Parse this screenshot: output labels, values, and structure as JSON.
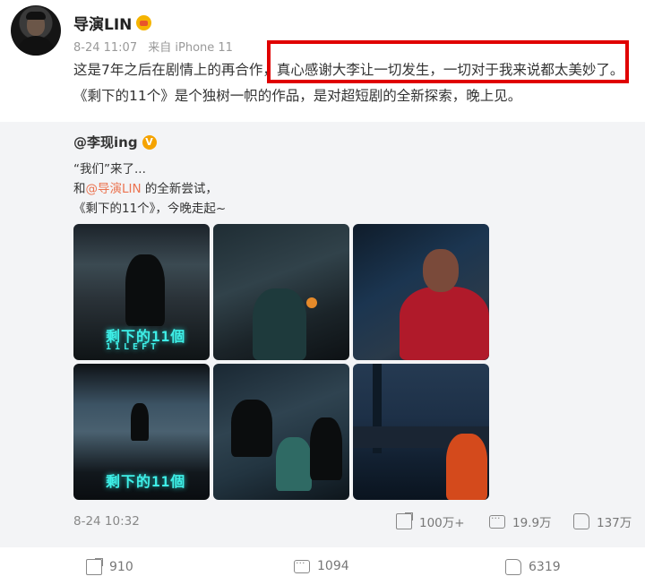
{
  "author": {
    "name": "导演LIN"
  },
  "meta": {
    "time": "8-24 11:07",
    "source": "来自 iPhone 11"
  },
  "post_text": "这是7年之后在剧情上的再合作，真心感谢大李让一切发生，一切对于我来说都太美妙了。《剩下的11个》是个独树一帜的作品，是对超短剧的全新探索，晚上见。",
  "repost": {
    "author": "@李现ing",
    "line1": "“我们”来了...",
    "line2_prefix": "和",
    "line2_mention": "@导演LIN",
    "line2_suffix": " 的全新尝试，",
    "line3": "《剩下的11个》，今晚走起~",
    "poster_title": "剩下的11個",
    "poster_subtitle": "11LEFT",
    "date": "8-24 10:32",
    "shares": "100万+",
    "comments": "19.9万",
    "likes": "137万"
  },
  "footer": {
    "shares": "910",
    "comments": "1094",
    "likes": "6319"
  },
  "colors": {
    "highlight_border": "#e00000",
    "mention": "#eb7350",
    "repost_bg": "#f3f4f6"
  }
}
